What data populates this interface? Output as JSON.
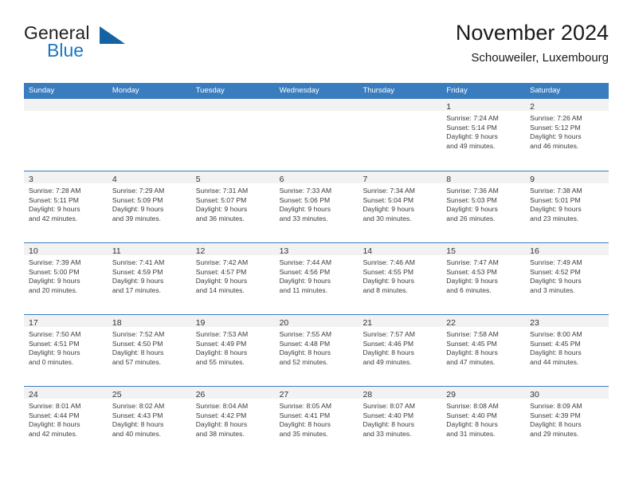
{
  "brand": {
    "word_one": "General",
    "word_two": "Blue",
    "triangle_icon": "triangle-icon",
    "accent_color": "#1464a5",
    "blue_text_color": "#1b77c4"
  },
  "header": {
    "title": "November 2024",
    "subtitle": "Schouweiler, Luxembourg"
  },
  "calendar": {
    "header_bg": "#3a7dbf",
    "day_band_bg": "#f2f2f2",
    "weekdays": [
      "Sunday",
      "Monday",
      "Tuesday",
      "Wednesday",
      "Thursday",
      "Friday",
      "Saturday"
    ],
    "weeks": [
      [
        {
          "day": "",
          "empty": true
        },
        {
          "day": "",
          "empty": true
        },
        {
          "day": "",
          "empty": true
        },
        {
          "day": "",
          "empty": true
        },
        {
          "day": "",
          "empty": true
        },
        {
          "day": "1",
          "sunrise": "Sunrise: 7:24 AM",
          "sunset": "Sunset: 5:14 PM",
          "daylight1": "Daylight: 9 hours",
          "daylight2": "and 49 minutes."
        },
        {
          "day": "2",
          "sunrise": "Sunrise: 7:26 AM",
          "sunset": "Sunset: 5:12 PM",
          "daylight1": "Daylight: 9 hours",
          "daylight2": "and 46 minutes."
        }
      ],
      [
        {
          "day": "3",
          "sunrise": "Sunrise: 7:28 AM",
          "sunset": "Sunset: 5:11 PM",
          "daylight1": "Daylight: 9 hours",
          "daylight2": "and 42 minutes."
        },
        {
          "day": "4",
          "sunrise": "Sunrise: 7:29 AM",
          "sunset": "Sunset: 5:09 PM",
          "daylight1": "Daylight: 9 hours",
          "daylight2": "and 39 minutes."
        },
        {
          "day": "5",
          "sunrise": "Sunrise: 7:31 AM",
          "sunset": "Sunset: 5:07 PM",
          "daylight1": "Daylight: 9 hours",
          "daylight2": "and 36 minutes."
        },
        {
          "day": "6",
          "sunrise": "Sunrise: 7:33 AM",
          "sunset": "Sunset: 5:06 PM",
          "daylight1": "Daylight: 9 hours",
          "daylight2": "and 33 minutes."
        },
        {
          "day": "7",
          "sunrise": "Sunrise: 7:34 AM",
          "sunset": "Sunset: 5:04 PM",
          "daylight1": "Daylight: 9 hours",
          "daylight2": "and 30 minutes."
        },
        {
          "day": "8",
          "sunrise": "Sunrise: 7:36 AM",
          "sunset": "Sunset: 5:03 PM",
          "daylight1": "Daylight: 9 hours",
          "daylight2": "and 26 minutes."
        },
        {
          "day": "9",
          "sunrise": "Sunrise: 7:38 AM",
          "sunset": "Sunset: 5:01 PM",
          "daylight1": "Daylight: 9 hours",
          "daylight2": "and 23 minutes."
        }
      ],
      [
        {
          "day": "10",
          "sunrise": "Sunrise: 7:39 AM",
          "sunset": "Sunset: 5:00 PM",
          "daylight1": "Daylight: 9 hours",
          "daylight2": "and 20 minutes."
        },
        {
          "day": "11",
          "sunrise": "Sunrise: 7:41 AM",
          "sunset": "Sunset: 4:59 PM",
          "daylight1": "Daylight: 9 hours",
          "daylight2": "and 17 minutes."
        },
        {
          "day": "12",
          "sunrise": "Sunrise: 7:42 AM",
          "sunset": "Sunset: 4:57 PM",
          "daylight1": "Daylight: 9 hours",
          "daylight2": "and 14 minutes."
        },
        {
          "day": "13",
          "sunrise": "Sunrise: 7:44 AM",
          "sunset": "Sunset: 4:56 PM",
          "daylight1": "Daylight: 9 hours",
          "daylight2": "and 11 minutes."
        },
        {
          "day": "14",
          "sunrise": "Sunrise: 7:46 AM",
          "sunset": "Sunset: 4:55 PM",
          "daylight1": "Daylight: 9 hours",
          "daylight2": "and 8 minutes."
        },
        {
          "day": "15",
          "sunrise": "Sunrise: 7:47 AM",
          "sunset": "Sunset: 4:53 PM",
          "daylight1": "Daylight: 9 hours",
          "daylight2": "and 6 minutes."
        },
        {
          "day": "16",
          "sunrise": "Sunrise: 7:49 AM",
          "sunset": "Sunset: 4:52 PM",
          "daylight1": "Daylight: 9 hours",
          "daylight2": "and 3 minutes."
        }
      ],
      [
        {
          "day": "17",
          "sunrise": "Sunrise: 7:50 AM",
          "sunset": "Sunset: 4:51 PM",
          "daylight1": "Daylight: 9 hours",
          "daylight2": "and 0 minutes."
        },
        {
          "day": "18",
          "sunrise": "Sunrise: 7:52 AM",
          "sunset": "Sunset: 4:50 PM",
          "daylight1": "Daylight: 8 hours",
          "daylight2": "and 57 minutes."
        },
        {
          "day": "19",
          "sunrise": "Sunrise: 7:53 AM",
          "sunset": "Sunset: 4:49 PM",
          "daylight1": "Daylight: 8 hours",
          "daylight2": "and 55 minutes."
        },
        {
          "day": "20",
          "sunrise": "Sunrise: 7:55 AM",
          "sunset": "Sunset: 4:48 PM",
          "daylight1": "Daylight: 8 hours",
          "daylight2": "and 52 minutes."
        },
        {
          "day": "21",
          "sunrise": "Sunrise: 7:57 AM",
          "sunset": "Sunset: 4:46 PM",
          "daylight1": "Daylight: 8 hours",
          "daylight2": "and 49 minutes."
        },
        {
          "day": "22",
          "sunrise": "Sunrise: 7:58 AM",
          "sunset": "Sunset: 4:45 PM",
          "daylight1": "Daylight: 8 hours",
          "daylight2": "and 47 minutes."
        },
        {
          "day": "23",
          "sunrise": "Sunrise: 8:00 AM",
          "sunset": "Sunset: 4:45 PM",
          "daylight1": "Daylight: 8 hours",
          "daylight2": "and 44 minutes."
        }
      ],
      [
        {
          "day": "24",
          "sunrise": "Sunrise: 8:01 AM",
          "sunset": "Sunset: 4:44 PM",
          "daylight1": "Daylight: 8 hours",
          "daylight2": "and 42 minutes."
        },
        {
          "day": "25",
          "sunrise": "Sunrise: 8:02 AM",
          "sunset": "Sunset: 4:43 PM",
          "daylight1": "Daylight: 8 hours",
          "daylight2": "and 40 minutes."
        },
        {
          "day": "26",
          "sunrise": "Sunrise: 8:04 AM",
          "sunset": "Sunset: 4:42 PM",
          "daylight1": "Daylight: 8 hours",
          "daylight2": "and 38 minutes."
        },
        {
          "day": "27",
          "sunrise": "Sunrise: 8:05 AM",
          "sunset": "Sunset: 4:41 PM",
          "daylight1": "Daylight: 8 hours",
          "daylight2": "and 35 minutes."
        },
        {
          "day": "28",
          "sunrise": "Sunrise: 8:07 AM",
          "sunset": "Sunset: 4:40 PM",
          "daylight1": "Daylight: 8 hours",
          "daylight2": "and 33 minutes."
        },
        {
          "day": "29",
          "sunrise": "Sunrise: 8:08 AM",
          "sunset": "Sunset: 4:40 PM",
          "daylight1": "Daylight: 8 hours",
          "daylight2": "and 31 minutes."
        },
        {
          "day": "30",
          "sunrise": "Sunrise: 8:09 AM",
          "sunset": "Sunset: 4:39 PM",
          "daylight1": "Daylight: 8 hours",
          "daylight2": "and 29 minutes."
        }
      ]
    ]
  }
}
